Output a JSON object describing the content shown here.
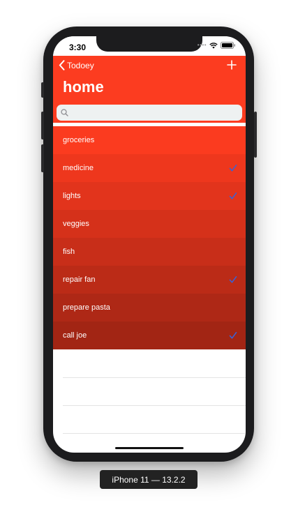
{
  "status_bar": {
    "time": "3:30"
  },
  "nav": {
    "back_label": "Todoey",
    "title": "home"
  },
  "search": {
    "placeholder": ""
  },
  "items": [
    {
      "label": "groceries",
      "checked": false,
      "color": "#fb3b1f"
    },
    {
      "label": "medicine",
      "checked": true,
      "color": "#ee371d"
    },
    {
      "label": "lights",
      "checked": true,
      "color": "#e2341c"
    },
    {
      "label": "veggies",
      "checked": false,
      "color": "#d5311a"
    },
    {
      "label": "fish",
      "checked": false,
      "color": "#c82e19"
    },
    {
      "label": "repair fan",
      "checked": true,
      "color": "#bb2b17"
    },
    {
      "label": "prepare pasta",
      "checked": false,
      "color": "#ae2816"
    },
    {
      "label": "call joe",
      "checked": true,
      "color": "#a22514"
    }
  ],
  "colors": {
    "nav_bar": "#fc3c20",
    "checkmark": "#3a62d6"
  },
  "device_caption": "iPhone 11 — 13.2.2"
}
